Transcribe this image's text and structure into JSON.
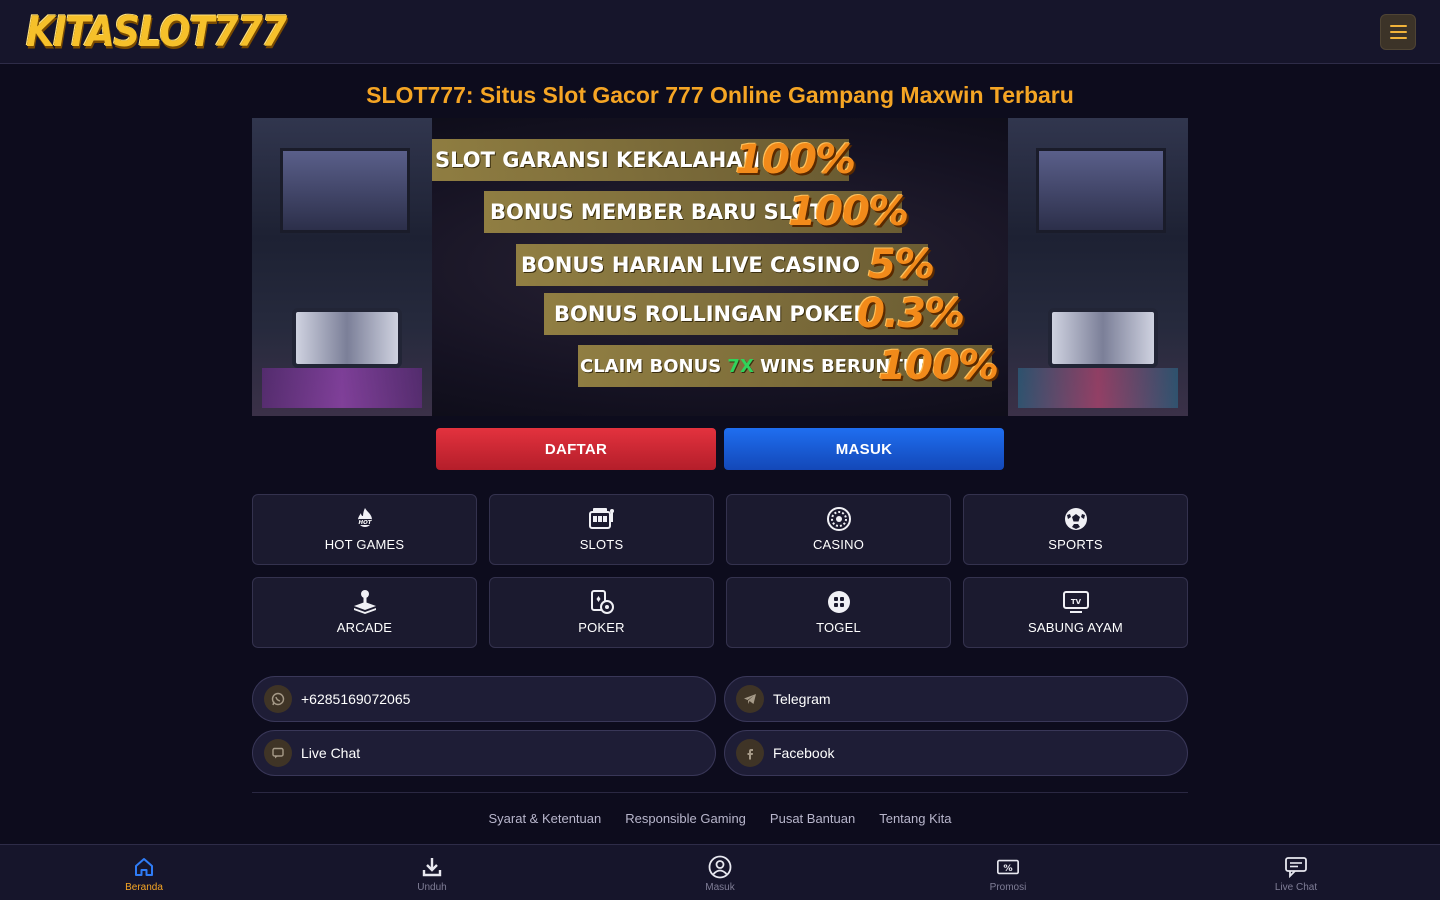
{
  "header": {
    "logo_text": "KITASLOT777",
    "menu_icon": "hamburger-icon"
  },
  "page_title": "SLOT777: Situs Slot Gacor 777 Online Gampang Maxwin Terbaru",
  "banner": {
    "rows": [
      {
        "text": "SLOT GARANSI KEKALAHAN",
        "value": "100%"
      },
      {
        "text": "BONUS MEMBER BARU SLOT",
        "value": "100%"
      },
      {
        "text": "BONUS HARIAN LIVE CASINO",
        "value": "5%"
      },
      {
        "text": "BONUS ROLLINGAN POKER",
        "value": "0.3%"
      },
      {
        "text_before": "CLAIM BONUS ",
        "highlight": "7X",
        "text_after": " WINS BERUNTUN",
        "value": "100%"
      }
    ],
    "highlight_color": "#2fd35a"
  },
  "auth": {
    "register_label": "DAFTAR",
    "login_label": "MASUK"
  },
  "games": [
    {
      "label": "HOT GAMES",
      "icon": "hot-flame-icon"
    },
    {
      "label": "SLOTS",
      "icon": "slot-machine-icon"
    },
    {
      "label": "CASINO",
      "icon": "roulette-icon"
    },
    {
      "label": "SPORTS",
      "icon": "soccer-ball-icon"
    },
    {
      "label": "ARCADE",
      "icon": "joystick-icon"
    },
    {
      "label": "POKER",
      "icon": "poker-cards-icon"
    },
    {
      "label": "TOGEL",
      "icon": "lottery-dice-icon"
    },
    {
      "label": "SABUNG AYAM",
      "icon": "tv-icon"
    }
  ],
  "contacts": [
    {
      "label": "+6285169072065",
      "icon": "whatsapp-icon"
    },
    {
      "label": "Telegram",
      "icon": "telegram-icon"
    },
    {
      "label": "Live Chat",
      "icon": "chat-icon"
    },
    {
      "label": "Facebook",
      "icon": "facebook-icon"
    }
  ],
  "footer_links": [
    "Syarat & Ketentuan",
    "Responsible Gaming",
    "Pusat Bantuan",
    "Tentang Kita"
  ],
  "bottom_nav": [
    {
      "label": "Beranda",
      "icon": "home-icon",
      "active": true
    },
    {
      "label": "Unduh",
      "icon": "download-icon",
      "active": false
    },
    {
      "label": "Masuk",
      "icon": "user-circle-icon",
      "active": false
    },
    {
      "label": "Promosi",
      "icon": "promo-ticket-icon",
      "active": false
    },
    {
      "label": "Live Chat",
      "icon": "chat-bubble-icon",
      "active": false
    }
  ],
  "colors": {
    "background": "#0d0c1d",
    "header": "#16152b",
    "accent": "#f5a524",
    "register_button": "#d42834",
    "login_button": "#1a5ed8",
    "icon_circle": "#3f3426"
  }
}
